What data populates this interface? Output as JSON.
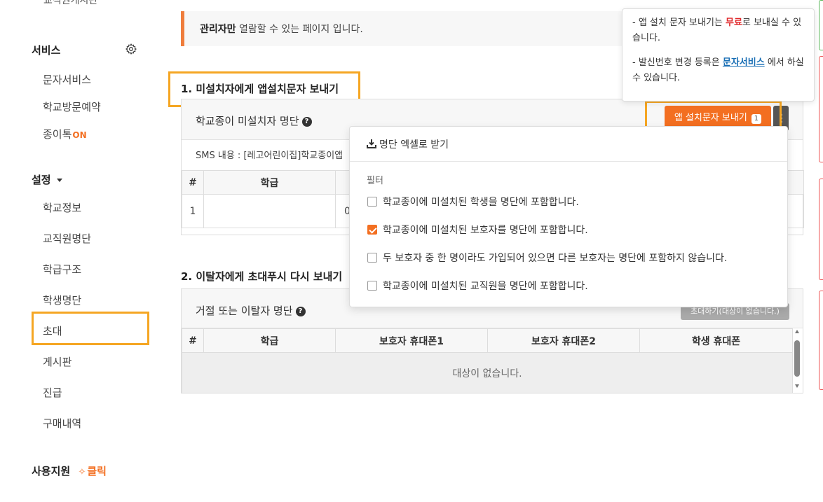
{
  "sidebar": {
    "cut_item": "교직원게시판",
    "service_section": "서비스",
    "service_items": [
      "문자서비스",
      "학교방문예약",
      "종이톡"
    ],
    "on_badge": "ON",
    "settings_section": "설정",
    "settings_items": [
      "학교정보",
      "교직원명단",
      "학급구조",
      "학생명단",
      "초대",
      "게시판",
      "진급",
      "구매내역"
    ],
    "support_section": "사용지원",
    "support_click": "클릭"
  },
  "alert": {
    "bold": "관리자만",
    "text": " 열람할 수 있는 페이지 입니다."
  },
  "section1": {
    "title": "1. 미설치자에게 앱설치문자 보내기",
    "panel_title": "학교종이 미설치자 명단",
    "sms_label": "SMS 내용 : [레고어린이집]학교종이앱",
    "send_button": "앱 설치문자 보내기",
    "send_count": "1",
    "table_headers": [
      "#",
      "학급"
    ],
    "rows": [
      [
        "1",
        "",
        "0"
      ]
    ]
  },
  "dropdown": {
    "excel_label": "명단 엑셀로 받기",
    "filter_label": "필터",
    "options": [
      {
        "label": "학교종이에 미설치된 학생을 명단에 포함합니다.",
        "checked": false
      },
      {
        "label": "학교종이에 미설치된 보호자를 명단에 포함합니다.",
        "checked": true
      },
      {
        "label": "두 보호자 중 한 명이라도 가입되어 있으면 다른 보호자는 명단에 포함하지 않습니다.",
        "checked": false
      },
      {
        "label": "학교종이에 미설치된 교직원을 명단에 포함합니다.",
        "checked": false
      }
    ]
  },
  "section2": {
    "title": "2. 이탈자에게 초대푸시 다시 보내기",
    "panel_title": "거절 또는 이탈자 명단",
    "invite_button": "초대하기(대상이 없습니다.)",
    "table_headers": [
      "#",
      "학급",
      "보호자 휴대폰1",
      "보호자 휴대폰2",
      "학생 휴대폰"
    ],
    "empty_text": "대상이 없습니다."
  },
  "tooltip": {
    "line1_pre": "- 앱 설치 문자 보내기는 ",
    "line1_free": "무료",
    "line1_post": "로 보내실 수 있습니다.",
    "line2_pre": "- 발신번호 변경 등록은 ",
    "line2_link": "문자서비스",
    "line2_post": " 에서 하실 수 있습니다."
  },
  "colors": {
    "accent": "#f36f21",
    "highlight": "#f5a623",
    "free": "#e0282b",
    "link": "#1a6fb5"
  }
}
